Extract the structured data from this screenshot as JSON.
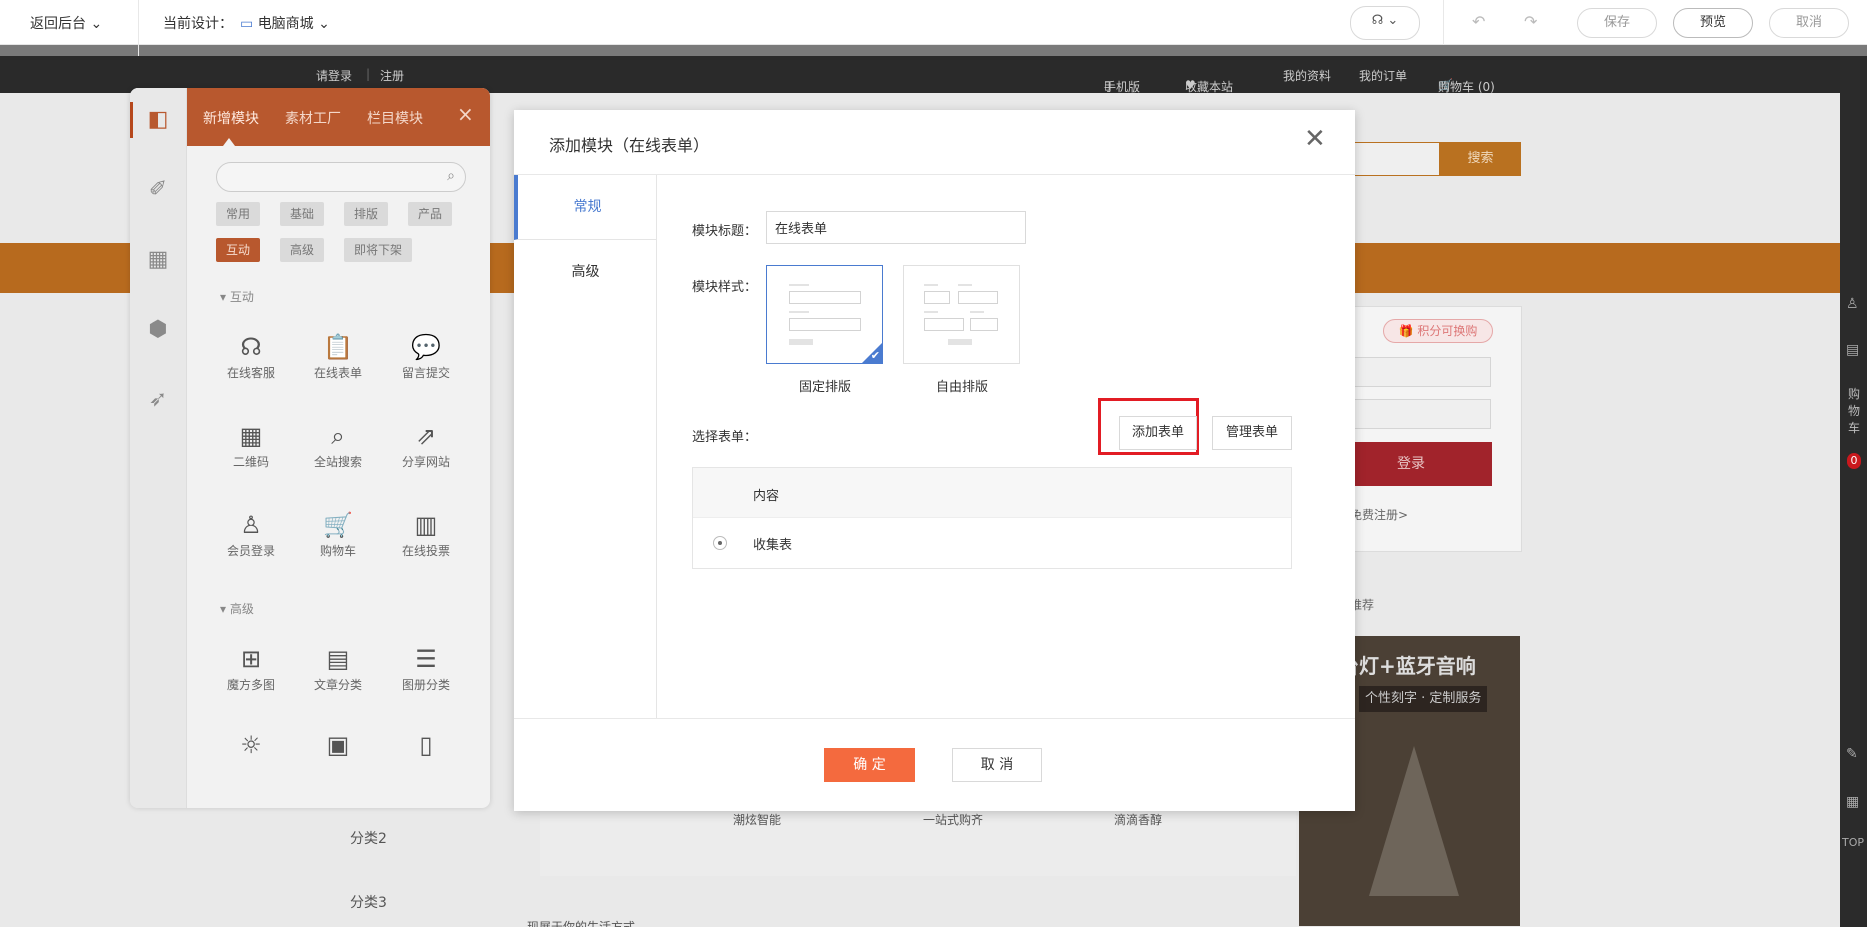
{
  "topbar": {
    "back_label": "返回后台",
    "current_design_label": "当前设计：",
    "design_target": "电脑商城",
    "save_label": "保存",
    "preview_label": "预览",
    "cancel_label": "取消"
  },
  "site": {
    "topnav": {
      "login": "请登录",
      "register": "注册",
      "mobile": "手机版",
      "favorite": "收藏本站",
      "profile": "我的资料",
      "orders": "我的订单",
      "cart": "购物车 (0)"
    },
    "search_button": "搜索",
    "points_tag": "积分可换购",
    "login_button": "登录",
    "free_register": "免费注册>",
    "recommend": "推荐",
    "banner_title": "台灯+蓝牙音响",
    "banner_subtitle": "个性刻字 · 定制服务",
    "products": [
      "潮炫智能",
      "一站式购齐",
      "滴滴香醇"
    ],
    "categories": [
      "分类2",
      "分类3"
    ],
    "footer_text": "现展于你的生活方式",
    "right_rail": {
      "cart_label": "购物车",
      "cart_count": "0",
      "top_label": "TOP"
    }
  },
  "panel": {
    "tabs": [
      "新增模块",
      "素材工厂",
      "栏目模块"
    ],
    "filters_row1": [
      "常用",
      "基础",
      "排版",
      "产品"
    ],
    "filters_row2": [
      "互动",
      "高级",
      "即将下架"
    ],
    "section_interactive": "互动",
    "section_advanced": "高级",
    "modules_interactive": [
      {
        "label": "在线客服",
        "icon": "headset-icon"
      },
      {
        "label": "在线表单",
        "icon": "clipboard-icon"
      },
      {
        "label": "留言提交",
        "icon": "message-icon"
      },
      {
        "label": "二维码",
        "icon": "qrcode-icon"
      },
      {
        "label": "全站搜索",
        "icon": "search-icon"
      },
      {
        "label": "分享网站",
        "icon": "share-icon"
      },
      {
        "label": "会员登录",
        "icon": "user-icon"
      },
      {
        "label": "购物车",
        "icon": "cart-icon"
      },
      {
        "label": "在线投票",
        "icon": "bar-chart-icon"
      }
    ],
    "modules_advanced": [
      {
        "label": "魔方多图",
        "icon": "grid-icon"
      },
      {
        "label": "文章分类",
        "icon": "article-icon"
      },
      {
        "label": "图册分类",
        "icon": "album-icon"
      }
    ]
  },
  "modal": {
    "title": "添加模块（在线表单）",
    "side_tabs": [
      "常规",
      "高级"
    ],
    "module_title_label": "模块标题：",
    "module_title_value": "在线表单",
    "module_style_label": "模块样式：",
    "styles": [
      "固定排版",
      "自由排版"
    ],
    "select_form_label": "选择表单：",
    "add_form_button": "添加表单",
    "manage_form_button": "管理表单",
    "table": {
      "header": "内容",
      "rows": [
        "收集表"
      ]
    },
    "confirm_button": "确 定",
    "cancel_button": "取 消"
  },
  "colors": {
    "accent_blue": "#4a7bd0",
    "confirm_orange": "#f46a3e",
    "highlight_red": "#e21c24",
    "panel_header": "#b8582e"
  }
}
